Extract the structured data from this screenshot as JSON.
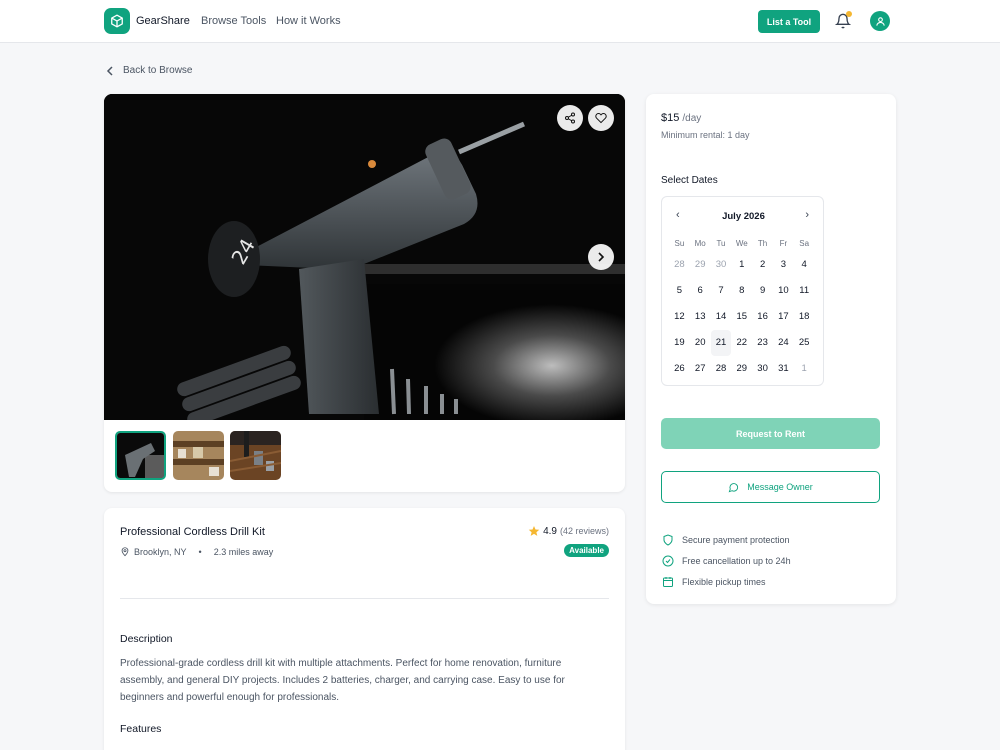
{
  "header": {
    "brand": "GearShare",
    "nav": [
      "Browse Tools",
      "How it Works"
    ],
    "list_button": "List a Tool",
    "icons": {
      "logo": "cube-logo-icon",
      "bell": "bell-icon",
      "avatar": "user-icon"
    }
  },
  "back_link": "Back to Browse",
  "listing": {
    "title": "Professional Cordless Drill Kit",
    "location": "Brooklyn, NY",
    "separator": "•",
    "distance": "2.3 miles away",
    "rating": "4.9",
    "reviews": "(42 reviews)",
    "status": "Available",
    "description_heading": "Description",
    "description": "Professional-grade cordless drill kit with multiple attachments. Perfect for home renovation, furniture assembly, and general DIY projects. Includes 2 batteries, charger, and carrying case. Easy to use for beginners and powerful enough for professionals.",
    "features_heading": "Features"
  },
  "booking": {
    "price": "$15",
    "per": "/day",
    "minimum": "Minimum rental: 1 day",
    "select_dates": "Select Dates",
    "month": "July 2026",
    "weekdays": [
      "Su",
      "Mo",
      "Tu",
      "We",
      "Th",
      "Fr",
      "Sa"
    ],
    "days": [
      "28",
      "29",
      "30",
      "1",
      "2",
      "3",
      "4",
      "5",
      "6",
      "7",
      "8",
      "9",
      "10",
      "11",
      "12",
      "13",
      "14",
      "15",
      "16",
      "17",
      "18",
      "19",
      "20",
      "21",
      "22",
      "23",
      "24",
      "25",
      "26",
      "27",
      "28",
      "29",
      "30",
      "31",
      "1"
    ],
    "muted_days": [
      0,
      1,
      2,
      34
    ],
    "today_index": 23,
    "request_button": "Request to Rent",
    "message_button": "Message Owner",
    "perks": [
      "Secure payment protection",
      "Free cancellation up to 24h",
      "Flexible pickup times"
    ]
  },
  "colors": {
    "accent": "#10a37f",
    "accent_light": "#7fd3b7",
    "star": "#f5b731"
  }
}
